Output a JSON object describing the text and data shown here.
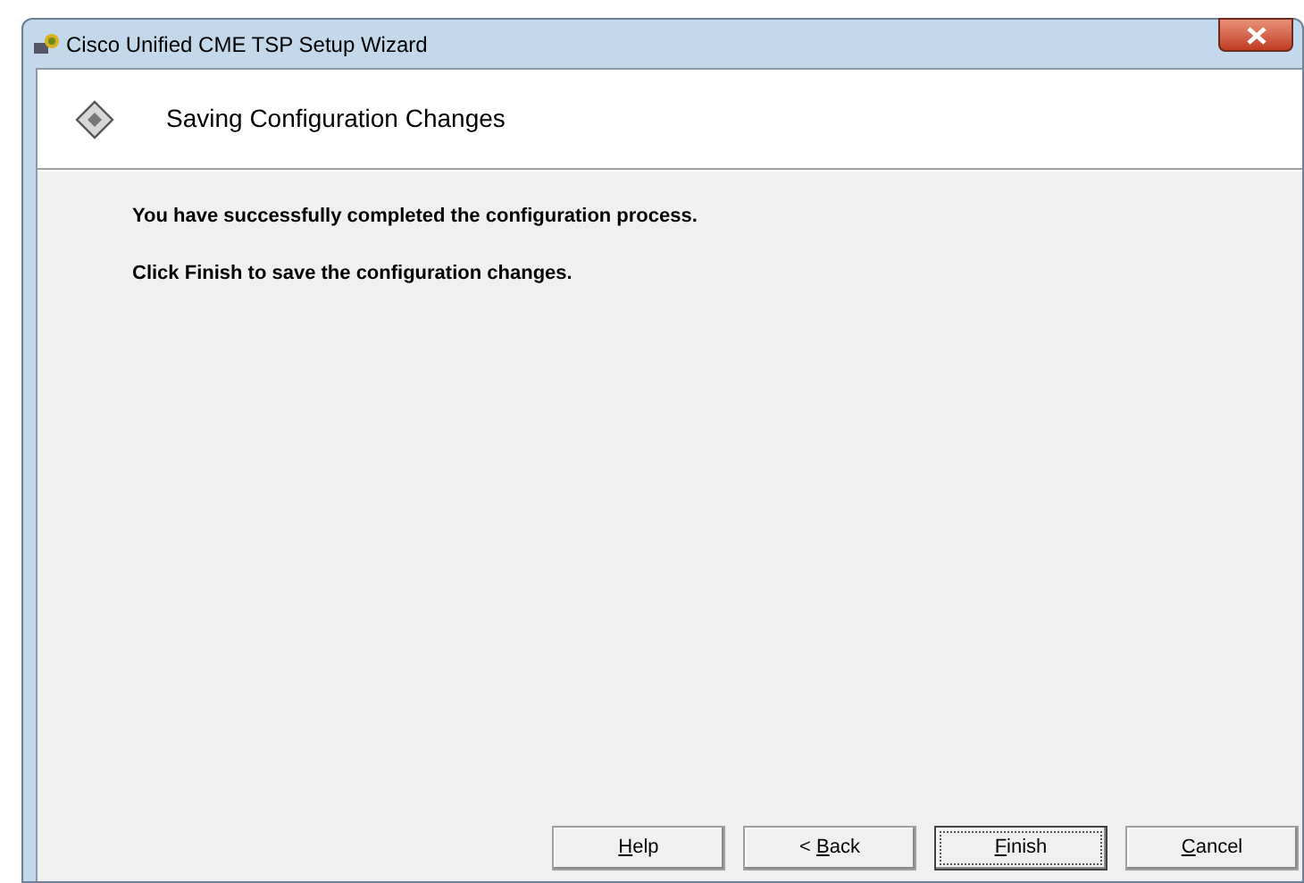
{
  "window": {
    "title": "Cisco Unified CME TSP Setup Wizard"
  },
  "header": {
    "title": "Saving Configuration Changes"
  },
  "messages": [
    "You have successfully completed the configuration process.",
    "Click Finish to save the configuration changes."
  ],
  "buttons": [
    {
      "access_key": "H",
      "rest": "elp",
      "focused": false
    },
    {
      "prefix": "< ",
      "access_key": "B",
      "rest": "ack",
      "focused": false
    },
    {
      "access_key": "F",
      "rest": "inish",
      "focused": true
    },
    {
      "access_key": "C",
      "rest": "ancel",
      "focused": false
    }
  ]
}
